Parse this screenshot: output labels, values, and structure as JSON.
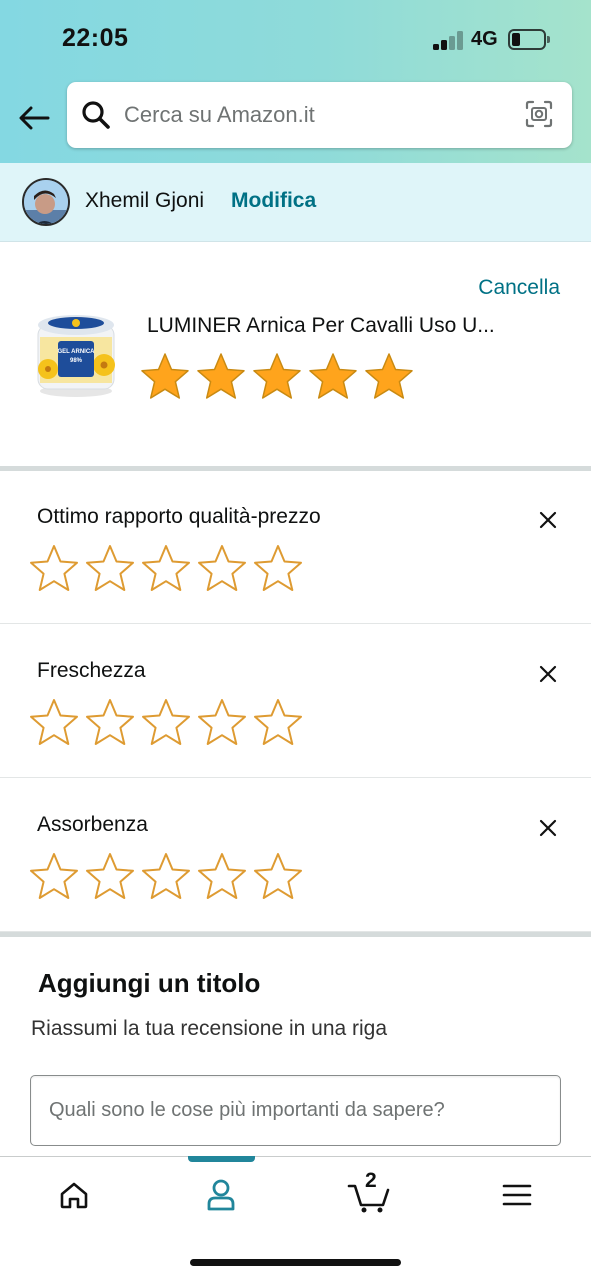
{
  "status": {
    "time": "22:05",
    "network": "4G"
  },
  "search": {
    "placeholder": "Cerca su Amazon.it"
  },
  "profile": {
    "name": "Xhemil Gjoni",
    "edit_label": "Modifica"
  },
  "product": {
    "cancel_label": "Cancella",
    "title": "LUMINER Arnica Per Cavalli Uso U...",
    "rating": 5,
    "rating_max": 5,
    "image_text": [
      "GEL ARNICA",
      "98%"
    ]
  },
  "attributes": [
    {
      "label": "Ottimo rapporto qualità-prezzo",
      "rating": 0
    },
    {
      "label": "Freschezza",
      "rating": 0
    },
    {
      "label": "Assorbenza",
      "rating": 0
    }
  ],
  "title_section": {
    "heading": "Aggiungi un titolo",
    "subtitle": "Riassumi la tua recensione in una riga",
    "placeholder": "Quali sono le cose più importanti da sapere?"
  },
  "nav": {
    "items": [
      "home-icon",
      "account-icon",
      "cart-icon",
      "menu-icon"
    ],
    "active": "account",
    "cart_count": "2"
  },
  "colors": {
    "accent": "#007185",
    "star_fill": "#FFA41C",
    "star_outline": "#DE9B32",
    "nav_active": "#21869b",
    "header_bg": "#84d8e2",
    "profile_bg": "#dff5f9"
  }
}
